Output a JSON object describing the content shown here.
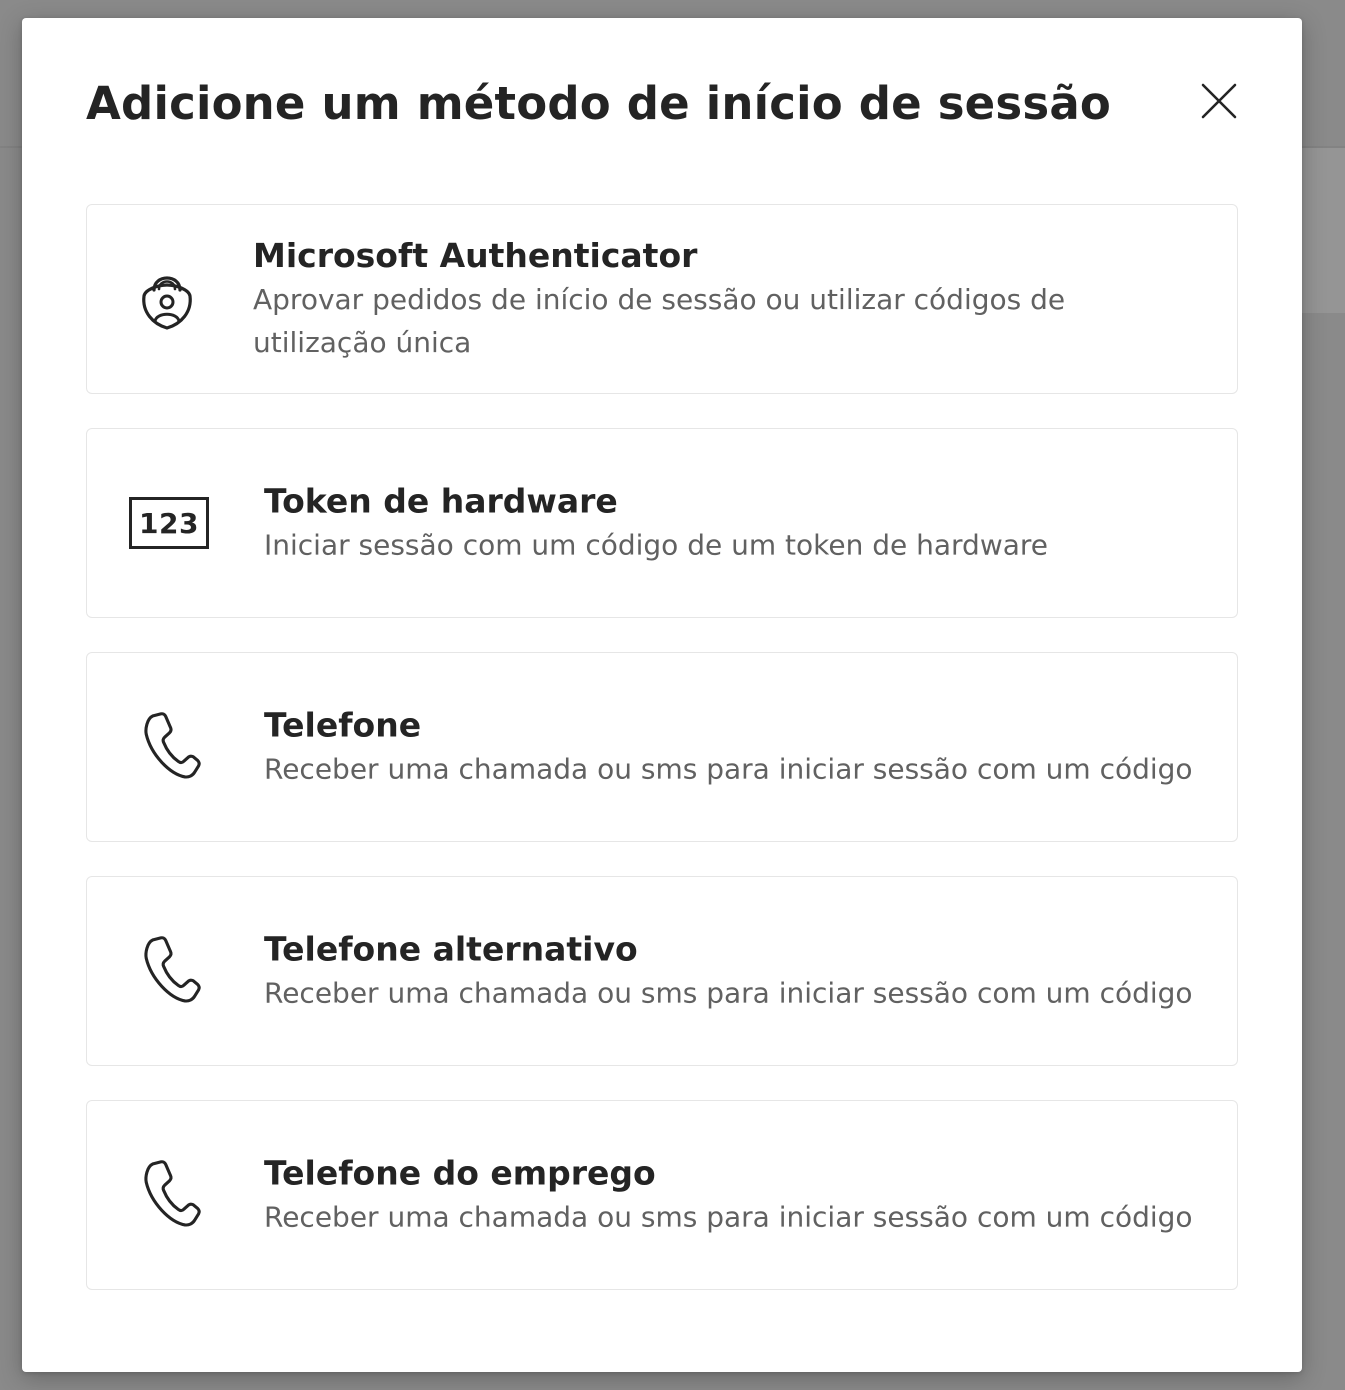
{
  "dialog": {
    "title": "Adicione um método de início de sessão",
    "close_icon": "close-icon"
  },
  "methods": [
    {
      "icon": "authenticator-lock-icon",
      "name": "Microsoft Authenticator",
      "description": "Aprovar pedidos de início de sessão ou utilizar códigos de utilização única"
    },
    {
      "icon": "hardware-token-icon",
      "icon_text": "123",
      "name": "Token de hardware",
      "description": "Iniciar sessão com um código de um token de hardware"
    },
    {
      "icon": "phone-icon",
      "name": "Telefone",
      "description": "Receber uma chamada ou sms para iniciar sessão com um código"
    },
    {
      "icon": "phone-icon",
      "name": "Telefone alternativo",
      "description": "Receber uma chamada ou sms para iniciar sessão com um código"
    },
    {
      "icon": "phone-icon",
      "name": "Telefone do emprego",
      "description": "Receber uma chamada ou sms para iniciar sessão com um código"
    }
  ],
  "colors": {
    "overlay": "#8a8a8a",
    "dialog_background": "#ffffff",
    "title_text": "#242424",
    "description_text": "#616161",
    "card_border": "#e6e6e6"
  }
}
